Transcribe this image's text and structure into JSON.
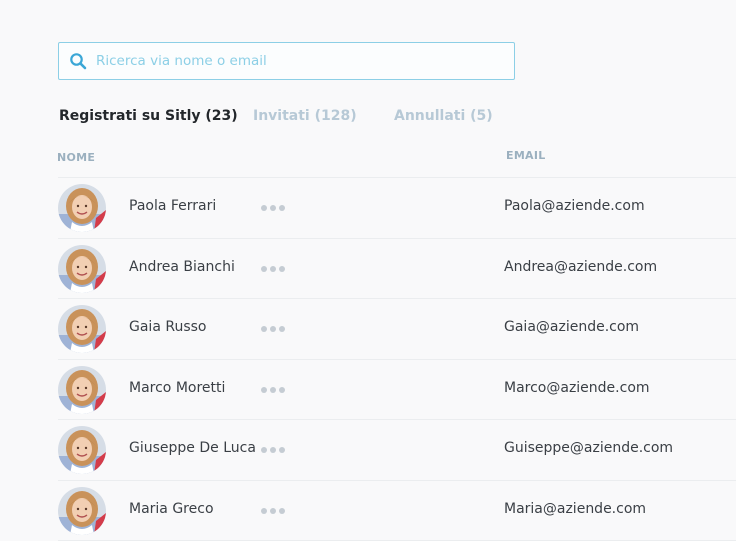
{
  "search": {
    "placeholder": "Ricerca via nome o email",
    "icon": "search-icon"
  },
  "tabs": [
    {
      "label": "Registrati su Sitly (23)",
      "active": true
    },
    {
      "label": "Invitati (128)",
      "active": false
    },
    {
      "label": "Annullati (5)",
      "active": false
    }
  ],
  "columns": {
    "name": "NOME",
    "email": "EMAIL"
  },
  "users": [
    {
      "name": "Paola Ferrari",
      "email": "Paola@aziende.com"
    },
    {
      "name": "Andrea Bianchi",
      "email": "Andrea@aziende.com"
    },
    {
      "name": "Gaia Russo",
      "email": "Gaia@aziende.com"
    },
    {
      "name": "Marco Moretti",
      "email": "Marco@aziende.com"
    },
    {
      "name": "Giuseppe De Luca",
      "email": "Guiseppe@aziende.com"
    },
    {
      "name": "Maria Greco",
      "email": "Maria@aziende.com"
    }
  ],
  "colors": {
    "accent": "#8ccfe6",
    "muted": "#b7c9d6",
    "text": "#3a3f45"
  }
}
